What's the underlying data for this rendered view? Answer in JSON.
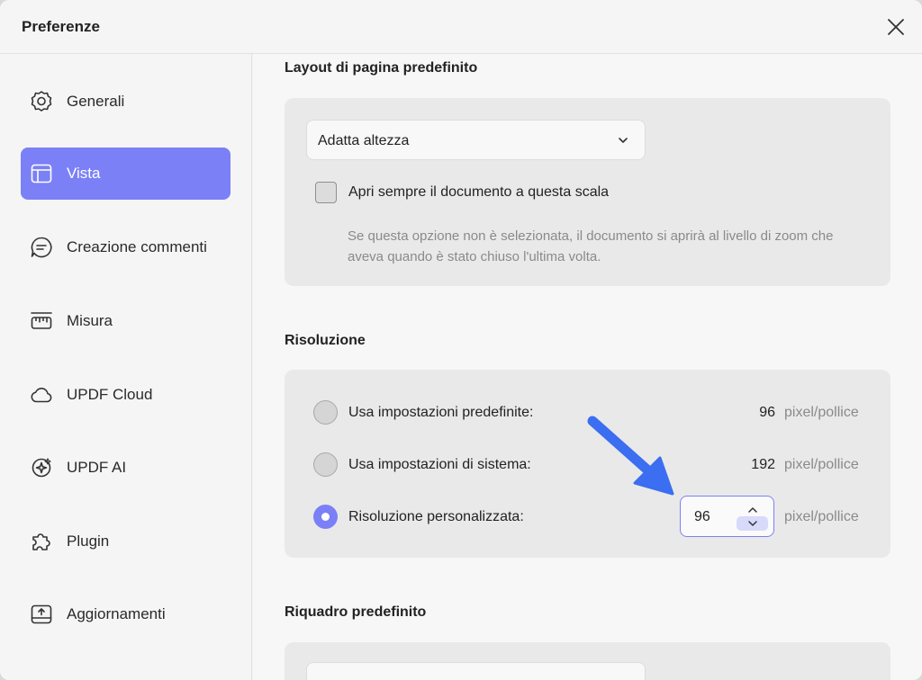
{
  "window": {
    "title": "Preferenze"
  },
  "sidebar": {
    "items": [
      {
        "label": "Generali",
        "icon": "gear-icon"
      },
      {
        "label": "Vista",
        "icon": "layout-icon",
        "active": true
      },
      {
        "label": "Creazione commenti",
        "icon": "comment-icon"
      },
      {
        "label": "Misura",
        "icon": "ruler-icon"
      },
      {
        "label": "UPDF Cloud",
        "icon": "cloud-icon"
      },
      {
        "label": "UPDF AI",
        "icon": "ai-sparkle-icon"
      },
      {
        "label": "Plugin",
        "icon": "puzzle-icon"
      },
      {
        "label": "Aggiornamenti",
        "icon": "update-icon"
      }
    ]
  },
  "layout_section": {
    "title": "Layout di pagina predefinito",
    "select_value": "Adatta altezza",
    "checkbox_label": "Apri sempre il documento a questa scala",
    "checkbox_checked": false,
    "hint": "Se questa opzione non è selezionata, il documento si aprirà al livello di zoom che aveva quando è stato chiuso l'ultima volta."
  },
  "resolution_section": {
    "title": "Risoluzione",
    "options": [
      {
        "label": "Usa impostazioni predefinite:",
        "value": "96",
        "unit": "pixel/pollice",
        "checked": false
      },
      {
        "label": "Usa impostazioni di sistema:",
        "value": "192",
        "unit": "pixel/pollice",
        "checked": false
      },
      {
        "label": "Risoluzione personalizzata:",
        "value": "96",
        "unit": "pixel/pollice",
        "checked": true
      }
    ]
  },
  "crop_section": {
    "title": "Riquadro predefinito"
  },
  "colors": {
    "accent": "#7b80f7",
    "annotation_arrow": "#3b6ef0"
  }
}
